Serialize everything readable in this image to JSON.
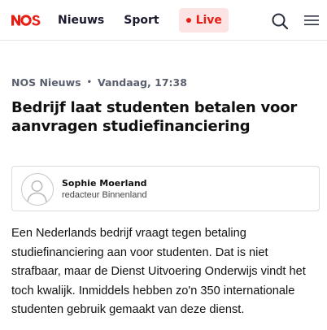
{
  "header": {
    "logo_text": "NOS",
    "nav": [
      {
        "label": "Nieuws"
      },
      {
        "label": "Sport"
      }
    ],
    "live_label": "Live",
    "search_icon": "search-icon",
    "menu_icon": "hamburger-menu-icon"
  },
  "article": {
    "source": "NOS Nieuws",
    "separator": "•",
    "timestamp": "Vandaag, 17:38",
    "title": "Bedrijf laat studenten betalen voor aanvragen studiefinanciering",
    "author": {
      "name": "Sophie Moerland",
      "role": "redacteur Binnenland",
      "avatar_icon": "user-avatar-icon"
    },
    "body": "Een Nederlands bedrijf vraagt tegen betaling studiefinanciering aan voor studenten. Dat is niet strafbaar, maar de Dienst Uitvoering Onderwijs vindt het toch kwalijk. Inmiddels hebben zo'n 350 internationale studenten gebruik gemaakt van deze dienst."
  },
  "colors": {
    "brand_red": "#e61e14",
    "live_bg": "#fde4e4",
    "meta_gray": "#5a5f6e"
  }
}
